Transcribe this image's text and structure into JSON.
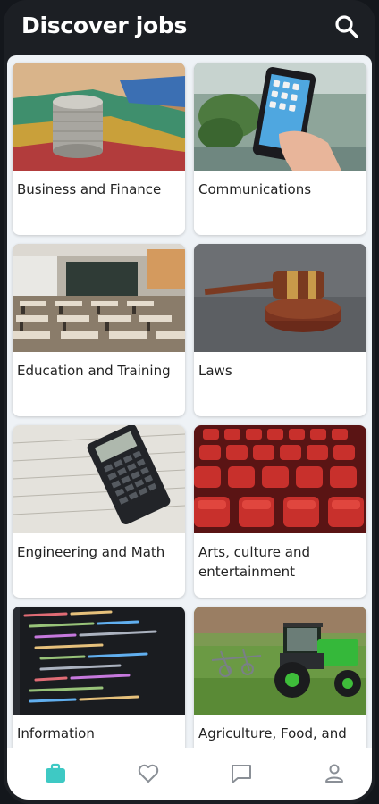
{
  "header": {
    "title": "Discover jobs"
  },
  "icons": {
    "search": "search-icon"
  },
  "categories": [
    {
      "label": "Business and Finance"
    },
    {
      "label": "Communications"
    },
    {
      "label": "Education and Training"
    },
    {
      "label": "Laws"
    },
    {
      "label": "Engineering and Math"
    },
    {
      "label": "Arts, culture and entertainment"
    },
    {
      "label": "Information"
    },
    {
      "label": "Agriculture, Food, and"
    }
  ],
  "bottom_nav": [
    {
      "icon": "briefcase-icon",
      "active": true
    },
    {
      "icon": "heart-icon",
      "active": false
    },
    {
      "icon": "chat-icon",
      "active": false
    },
    {
      "icon": "person-icon",
      "active": false
    }
  ],
  "colors": {
    "accent": "#3ec9c4",
    "inactive": "#8a8f96",
    "header_bg": "#1c1f24"
  }
}
